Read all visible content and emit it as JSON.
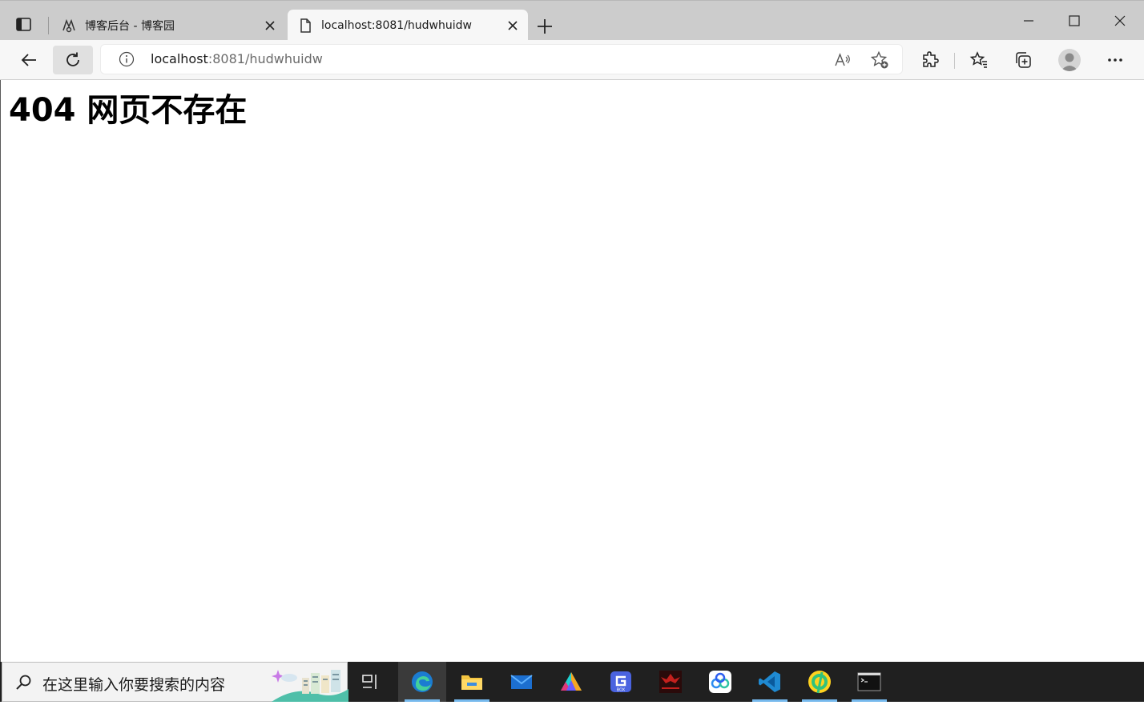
{
  "tabs": [
    {
      "title": "博客后台 - 博客园",
      "active": false,
      "icon": "cnblogs-icon"
    },
    {
      "title": "localhost:8081/hudwhuidw",
      "active": true,
      "icon": "page-icon"
    }
  ],
  "address": {
    "host": "localhost",
    "path": ":8081/hudwhuidw"
  },
  "page": {
    "heading": "404 网页不存在"
  },
  "taskbar": {
    "search_placeholder": "在这里输入你要搜索的内容",
    "apps": [
      "task-view",
      "edge",
      "file-explorer",
      "mail",
      "aurora-app",
      "gbox",
      "naraka",
      "baidu-netdisk",
      "vscode",
      "qq-music",
      "terminal"
    ]
  },
  "colors": {
    "tabstrip": "#cccccc",
    "toolbar": "#f7f7f7",
    "taskbar": "#202020",
    "accent": "#76b9ed"
  }
}
